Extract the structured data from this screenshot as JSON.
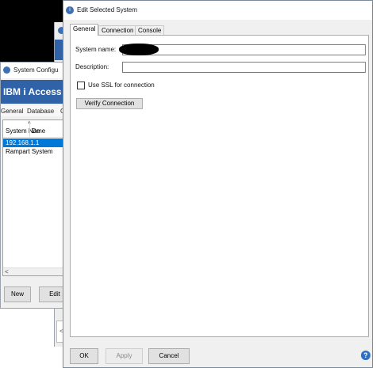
{
  "dialog": {
    "title": "Edit Selected System",
    "tabs": [
      {
        "label": "General",
        "active": true
      },
      {
        "label": "Connection",
        "active": false
      },
      {
        "label": "Console",
        "active": false
      }
    ],
    "general": {
      "system_name_label": "System name:",
      "system_name_value": "",
      "description_label": "Description:",
      "description_value": "",
      "ssl_label": "Use SSL for connection",
      "ssl_checked": false,
      "verify_button": "Verify Connection"
    },
    "buttons": {
      "ok": "OK",
      "apply": "Apply",
      "cancel": "Cancel",
      "help": "?"
    }
  },
  "background_window": {
    "title": "System Configu",
    "banner": "IBM i Access C",
    "menu": [
      "General",
      "Database",
      "C"
    ],
    "columns": [
      "System Name",
      "De"
    ],
    "rows": [
      {
        "name": "192.168.1.1",
        "selected": true
      },
      {
        "name": "Rampart System",
        "selected": false
      }
    ],
    "scroll_left": "<",
    "buttons": {
      "new": "New",
      "edit": "Edit"
    }
  },
  "back_window": {
    "scroll_left": "<"
  },
  "colors": {
    "banner": "#2f62a6",
    "selection": "#0078d7",
    "dialog_bg": "#f0f0f0"
  }
}
